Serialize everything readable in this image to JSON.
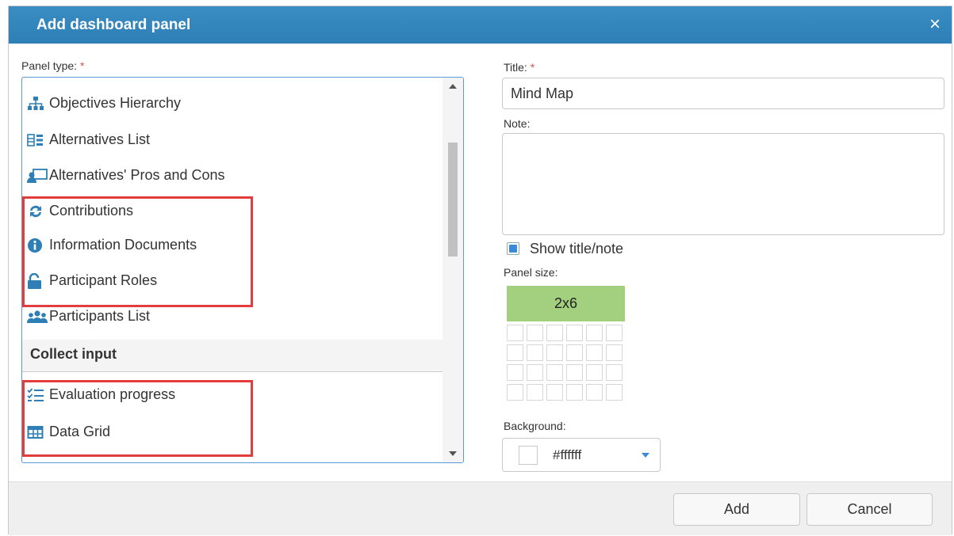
{
  "dialog": {
    "title": "Add dashboard panel",
    "close_label": "×"
  },
  "panel_type": {
    "label": "Panel type:",
    "required_mark": "*",
    "items": [
      {
        "label": "Objectives Hierarchy",
        "icon": "hierarchy-icon"
      },
      {
        "label": "Alternatives List",
        "icon": "list-icon"
      },
      {
        "label": "Alternatives' Pros and Cons",
        "icon": "pros-cons-icon"
      },
      {
        "label": "Contributions",
        "icon": "refresh-icon"
      },
      {
        "label": "Information Documents",
        "icon": "info-icon"
      },
      {
        "label": "Participant Roles",
        "icon": "unlock-icon"
      },
      {
        "label": "Participants List",
        "icon": "people-icon"
      }
    ],
    "group_label": "Collect input",
    "group_items": [
      {
        "label": "Evaluation progress",
        "icon": "checklist-icon"
      },
      {
        "label": "Data Grid",
        "icon": "grid-icon"
      }
    ]
  },
  "title_field": {
    "label": "Title:",
    "required_mark": "*",
    "value": "Mind Map"
  },
  "note_field": {
    "label": "Note:",
    "value": ""
  },
  "show_title_note": {
    "label": "Show title/note",
    "checked": true
  },
  "panel_size": {
    "label": "Panel size:",
    "value": "2x6"
  },
  "background": {
    "label": "Background:",
    "value": "#ffffff"
  },
  "footer": {
    "add_label": "Add",
    "cancel_label": "Cancel"
  },
  "colors": {
    "titlebar": "#2d7fb6",
    "highlight": "#e23c3c",
    "size_selected": "#a3d07f",
    "checkbox": "#3a8ad6"
  }
}
